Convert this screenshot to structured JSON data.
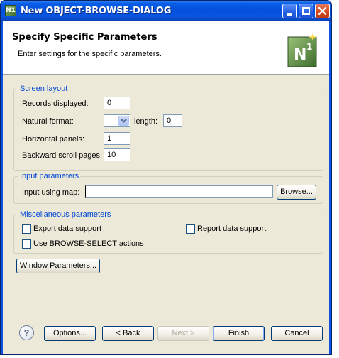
{
  "window": {
    "title": "New OBJECT-BROWSE-DIALOG",
    "app_icon": "N1"
  },
  "header": {
    "title": "Specify Specific Parameters",
    "message": "Enter settings for the specific parameters.",
    "banner_icon": "natural-n1-icon"
  },
  "screen_layout": {
    "group_title": "Screen layout",
    "records_label": "Records displayed:",
    "records_value": "0",
    "natural_format_label": "Natural format:",
    "natural_format_value": "",
    "length_label": "length:",
    "length_value": "0",
    "horizontal_panels_label": "Horizontal panels:",
    "horizontal_panels_value": "1",
    "backward_scroll_label": "Backward scroll pages:",
    "backward_scroll_value": "10"
  },
  "input_parameters": {
    "group_title": "Input parameters",
    "map_label": "Input using map:",
    "map_value": "",
    "browse_label": "Browse..."
  },
  "misc": {
    "group_title": "Miscellaneous parameters",
    "export_label": "Export data support",
    "export_checked": false,
    "report_label": "Report data support",
    "report_checked": false,
    "browse_select_label": "Use BROWSE-SELECT actions",
    "browse_select_checked": false
  },
  "window_parameters_label": "Window Parameters...",
  "footer": {
    "options_label": "Options...",
    "back_label": "< Back",
    "next_label": "Next >",
    "finish_label": "Finish",
    "cancel_label": "Cancel"
  }
}
